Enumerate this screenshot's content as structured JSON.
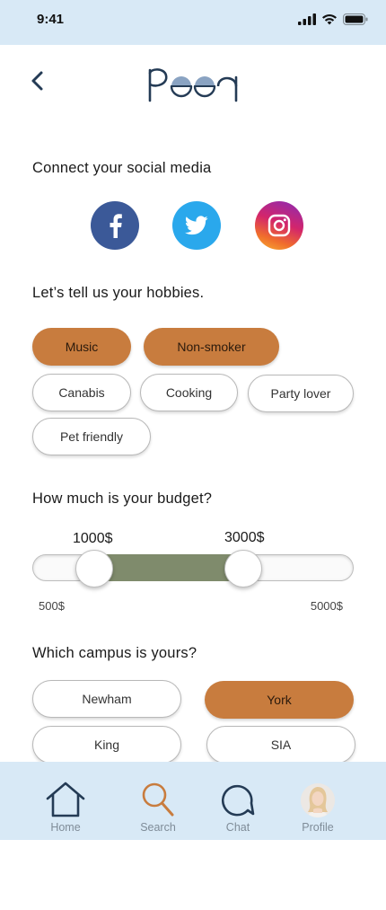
{
  "status_bar": {
    "time": "9:41"
  },
  "header": {
    "back_icon": "chevron-left-icon",
    "logo_text": "peeq"
  },
  "social": {
    "title": "Connect your social media",
    "networks": [
      {
        "name": "Facebook",
        "icon": "facebook-icon",
        "color": "#3b5998"
      },
      {
        "name": "Twitter",
        "icon": "twitter-icon",
        "color": "#2aa8ec"
      },
      {
        "name": "Instagram",
        "icon": "instagram-icon",
        "color": "#d3256b"
      }
    ]
  },
  "hobbies": {
    "title": "Let’s tell us your hobbies.",
    "items": [
      {
        "label": "Music",
        "selected": true
      },
      {
        "label": "Non-smoker",
        "selected": true
      },
      {
        "label": "Canabis",
        "selected": false
      },
      {
        "label": "Cooking",
        "selected": false
      },
      {
        "label": "Party lover",
        "selected": false
      },
      {
        "label": "Pet friendly",
        "selected": false
      }
    ]
  },
  "budget": {
    "title": "How much is your budget?",
    "min": 500,
    "max": 5000,
    "low": 1000,
    "high": 3000,
    "low_label": "1000$",
    "high_label": "3000$",
    "min_label": "500$",
    "max_label": "5000$",
    "fill_color": "#7f8b6c"
  },
  "campus": {
    "title": "Which campus is yours?",
    "items": [
      {
        "label": "Newham",
        "selected": false
      },
      {
        "label": "York",
        "selected": true
      },
      {
        "label": "King",
        "selected": false
      },
      {
        "label": "SIA",
        "selected": false
      }
    ]
  },
  "tab_bar": {
    "tabs": [
      {
        "label": "Home",
        "icon": "home-icon",
        "active": false
      },
      {
        "label": "Search",
        "icon": "search-icon",
        "active": true
      },
      {
        "label": "Chat",
        "icon": "chat-icon",
        "active": false
      },
      {
        "label": "Profile",
        "icon": "avatar",
        "active": false
      }
    ]
  },
  "colors": {
    "accent": "#c87c3e",
    "bar_background": "#d8e9f6",
    "navy": "#243b55"
  }
}
